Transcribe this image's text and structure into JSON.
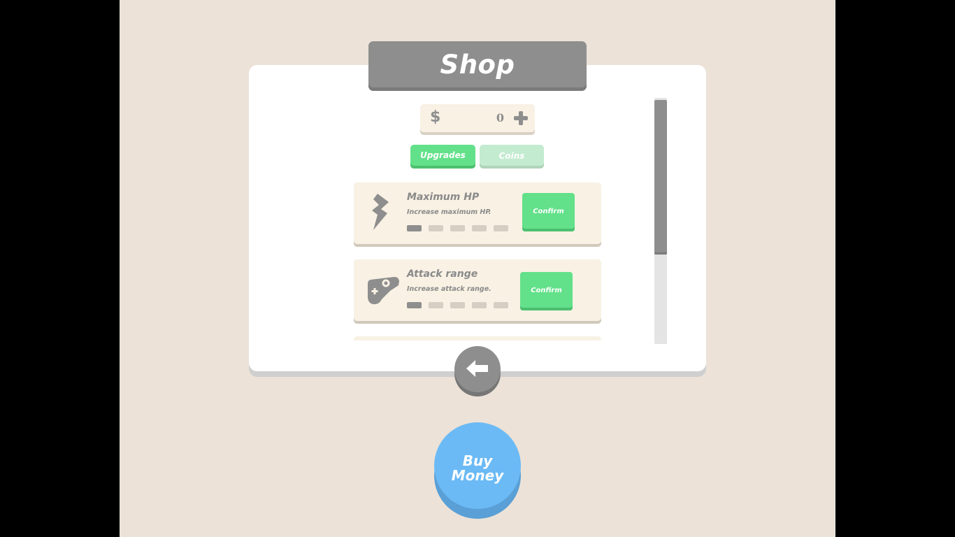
{
  "shop": {
    "title": "Shop",
    "currency_symbol": "$",
    "balance": "0"
  },
  "tabs": [
    {
      "label": "Upgrades",
      "active": true
    },
    {
      "label": "Coins",
      "active": false
    }
  ],
  "upgrades": [
    {
      "name": "Maximum HP",
      "description": "Increase maximum HP.",
      "level": 1,
      "max_level": 5,
      "button": "Confirm",
      "icon": "lightning-icon"
    },
    {
      "name": "Attack range",
      "description": "Increase attack range.",
      "level": 1,
      "max_level": 5,
      "button": "Confirm",
      "icon": "gamepad-icon"
    }
  ],
  "buy_button": {
    "line1": "Buy",
    "line2": "Money"
  },
  "colors": {
    "background": "#ece2d8",
    "panel": "#ffffff",
    "accent_green": "#63e08a",
    "accent_blue": "#6bbaf5",
    "neutral_gray": "#8e8e8e"
  }
}
